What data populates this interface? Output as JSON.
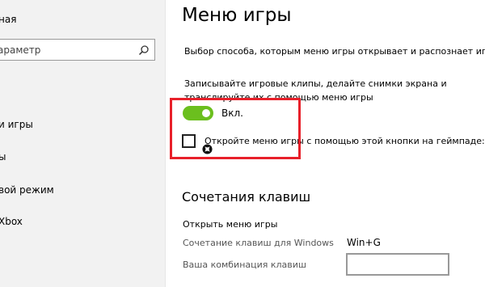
{
  "sidebar": {
    "header": "ная",
    "search_placeholder": "араметр",
    "items": [
      {
        "label": "и игры"
      },
      {
        "label": "ы"
      },
      {
        "label": "вой режим"
      },
      {
        "label": "Xbox"
      }
    ]
  },
  "main": {
    "title": "Меню игры",
    "description": "Выбор способа, которым меню игры открывает и распознает игру",
    "record_text": "Записывайте игровые клипы, делайте снимки экрана и транслируйте их с помощью меню игры",
    "toggle": {
      "state": "on",
      "label": "Вкл."
    },
    "checkbox": {
      "checked": false,
      "label": "Откройте меню игры с помощью этой кнопки на геймпаде:"
    },
    "shortcuts": {
      "section_title": "Сочетания клавиш",
      "subhead": "Открыть меню игры",
      "windows_label": "Сочетание клавиш для Windows",
      "windows_value": "Win+G",
      "custom_label": "Ваша комбинация клавиш",
      "custom_value": ""
    }
  },
  "colors": {
    "toggle_on": "#6bbf1e",
    "highlight": "#e8202a"
  },
  "icons": {
    "search": "search-icon",
    "controller": "xbox-icon"
  }
}
